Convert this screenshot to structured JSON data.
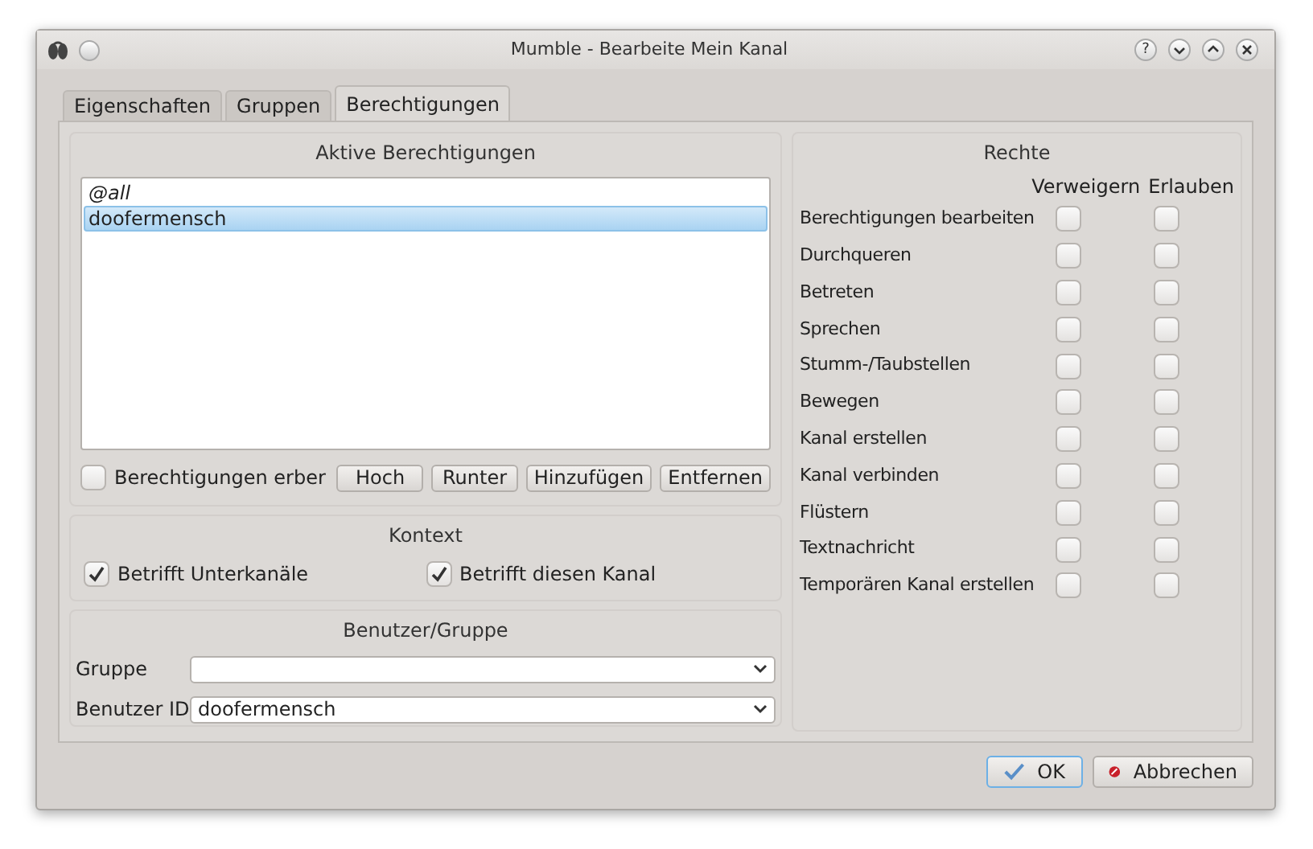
{
  "window": {
    "title": "Mumble - Bearbeite Mein Kanal",
    "controls": [
      {
        "kind": "help",
        "label": "?"
      },
      {
        "kind": "minimize"
      },
      {
        "kind": "maximize"
      },
      {
        "kind": "close"
      }
    ]
  },
  "tabs": [
    {
      "label": "Eigenschaften",
      "selected": false
    },
    {
      "label": "Gruppen",
      "selected": false
    },
    {
      "label": "Berechtigungen",
      "selected": true
    }
  ],
  "active_permissions": {
    "title": "Aktive Berechtigungen",
    "items": [
      {
        "label": "@all",
        "italic": true,
        "selected": false
      },
      {
        "label": "doofermensch",
        "italic": false,
        "selected": true
      }
    ],
    "inherit": {
      "label": "Berechtigungen erber",
      "checked": false
    },
    "buttons": [
      "Hoch",
      "Runter",
      "Hinzufügen",
      "Entfernen"
    ]
  },
  "context": {
    "title": "Kontext",
    "options": [
      {
        "label": "Betrifft Unterkanäle",
        "checked": true
      },
      {
        "label": "Betrifft diesen Kanal",
        "checked": true
      }
    ]
  },
  "user_group": {
    "title": "Benutzer/Gruppe",
    "fields": [
      {
        "label": "Gruppe"
      },
      {
        "label": "Benutzer ID",
        "value": "doofermensch"
      }
    ]
  },
  "rights": {
    "title": "Rechte",
    "columns": [
      "Verweigern",
      "Erlauben"
    ],
    "rows": [
      {
        "label": "Berechtigungen bearbeiten",
        "deny": false,
        "allow": false
      },
      {
        "label": "Durchqueren",
        "deny": false,
        "allow": false
      },
      {
        "label": "Betreten",
        "deny": false,
        "allow": false
      },
      {
        "label": "Sprechen",
        "deny": false,
        "allow": false
      },
      {
        "label": "Stumm-/Taubstellen",
        "deny": false,
        "allow": false
      },
      {
        "label": "Bewegen",
        "deny": false,
        "allow": false
      },
      {
        "label": "Kanal erstellen",
        "deny": false,
        "allow": false
      },
      {
        "label": "Kanal verbinden",
        "deny": false,
        "allow": false
      },
      {
        "label": "Flüstern",
        "deny": false,
        "allow": false
      },
      {
        "label": "Textnachricht",
        "deny": false,
        "allow": false
      },
      {
        "label": "Temporären Kanal erstellen",
        "deny": false,
        "allow": false
      }
    ]
  },
  "footer_buttons": [
    {
      "kind": "ok",
      "label": "OK",
      "default": true
    },
    {
      "kind": "cancel",
      "label": "Abbrechen",
      "default": false
    }
  ]
}
